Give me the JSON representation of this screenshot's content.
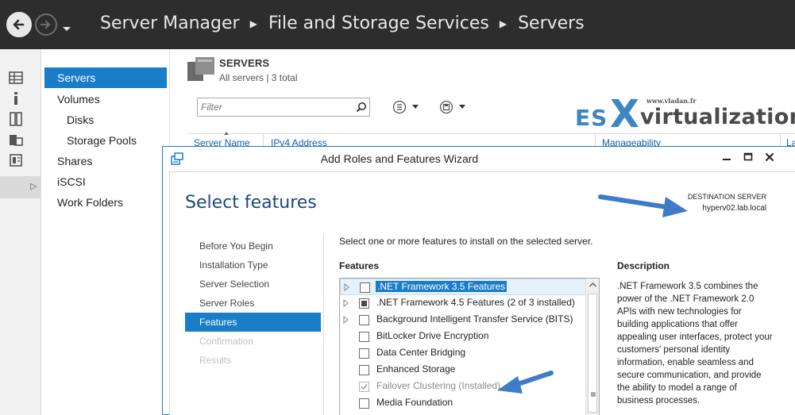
{
  "titlebar": {
    "breadcrumb": [
      "Server Manager",
      "File and Storage Services",
      "Servers"
    ],
    "bg_color": "#2d2d2d"
  },
  "nav": {
    "items": [
      {
        "label": "Servers",
        "selected": true
      },
      {
        "label": "Volumes"
      },
      {
        "label": "Disks"
      },
      {
        "label": "Storage Pools"
      },
      {
        "label": "Shares"
      },
      {
        "label": "iSCSI"
      },
      {
        "label": "Work Folders"
      }
    ],
    "selected_color": "#1a7dc8"
  },
  "servers_panel": {
    "title": "SERVERS",
    "subtitle": "All servers | 3 total",
    "filter_placeholder": "Filter",
    "columns": [
      "Server Name",
      "IPv4 Address",
      "Manageability",
      "La"
    ]
  },
  "watermark": {
    "url": "www.vladan.fr",
    "part1": "ES",
    "part2": "X",
    "part3": "virtualization"
  },
  "wizard": {
    "title": "Add Roles and Features Wizard",
    "heading": "Select features",
    "destination_label": "DESTINATION SERVER",
    "destination_server": "hyperv02.lab.local",
    "steps": [
      {
        "label": "Before You Begin",
        "state": "normal"
      },
      {
        "label": "Installation Type",
        "state": "normal"
      },
      {
        "label": "Server Selection",
        "state": "normal"
      },
      {
        "label": "Server Roles",
        "state": "normal"
      },
      {
        "label": "Features",
        "state": "selected"
      },
      {
        "label": "Confirmation",
        "state": "disabled"
      },
      {
        "label": "Results",
        "state": "disabled"
      }
    ],
    "intro": "Select one or more features to install on the selected server.",
    "features_label": "Features",
    "description_label": "Description",
    "description_text": ".NET Framework 3.5 combines the power of the .NET Framework 2.0 APIs with new technologies for building applications that offer appealing user interfaces, protect your customers' personal identity information, enable seamless and secure communication, and provide the ability to model a range of business processes.",
    "features": [
      {
        "label": ".NET Framework 3.5 Features",
        "expandable": true,
        "check": "none",
        "highlight": true
      },
      {
        "label": ".NET Framework 4.5 Features (2 of 3 installed)",
        "expandable": true,
        "check": "partial"
      },
      {
        "label": "Background Intelligent Transfer Service (BITS)",
        "expandable": true,
        "check": "none"
      },
      {
        "label": "BitLocker Drive Encryption",
        "expandable": false,
        "check": "none"
      },
      {
        "label": "Data Center Bridging",
        "expandable": false,
        "check": "none"
      },
      {
        "label": "Enhanced Storage",
        "expandable": false,
        "check": "none"
      },
      {
        "label": "Failover Clustering (Installed)",
        "expandable": false,
        "check": "checked-disabled"
      },
      {
        "label": "Media Foundation",
        "expandable": false,
        "check": "none"
      }
    ]
  },
  "colors": {
    "accent": "#1a7dc8",
    "heading": "#1d4a7a",
    "arrow": "#3f7cc8"
  }
}
